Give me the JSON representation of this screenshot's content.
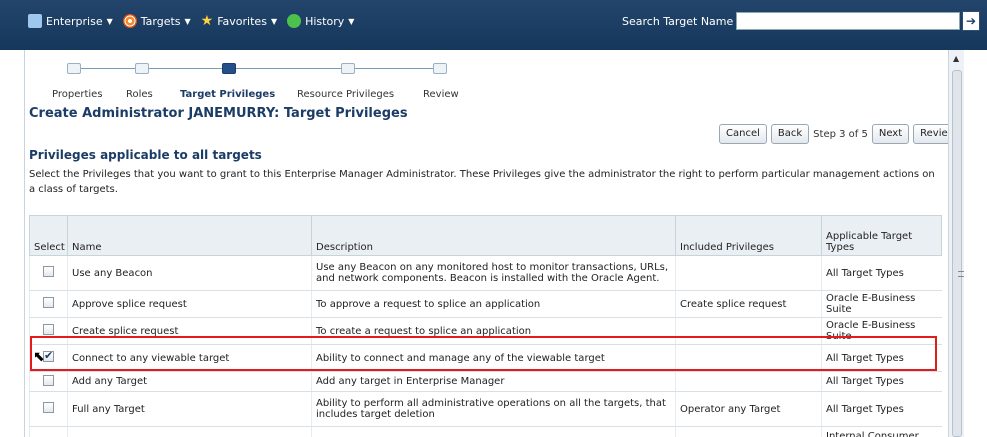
{
  "topbar": {
    "menus": [
      {
        "label": "Enterprise",
        "icon": "enterprise-icon"
      },
      {
        "label": "Targets",
        "icon": "targets-icon"
      },
      {
        "label": "Favorites",
        "icon": "star-icon"
      },
      {
        "label": "History",
        "icon": "history-icon"
      }
    ],
    "search_label": "Search Target Name",
    "search_value": ""
  },
  "train": {
    "steps": [
      "Properties",
      "Roles",
      "Target Privileges",
      "Resource Privileges",
      "Review"
    ],
    "active_index": 2
  },
  "page_title": "Create Administrator JANEMURRY: Target Privileges",
  "buttons": {
    "cancel": "Cancel",
    "back": "Back",
    "step": "Step 3 of 5",
    "next": "Next",
    "review": "Review"
  },
  "section_title": "Privileges applicable to all targets",
  "section_desc": "Select the Privileges that you want to grant to this Enterprise Manager Administrator. These Privileges give the administrator the right to perform particular management actions on a class of targets.",
  "table": {
    "columns": [
      "Select",
      "Name",
      "Description",
      "Included Privileges",
      "Applicable Target Types"
    ],
    "rows": [
      {
        "checked": false,
        "name": "Use any Beacon",
        "description": "Use any Beacon on any monitored host to monitor transactions, URLs, and network components. Beacon is installed with the Oracle Agent.",
        "included": "",
        "types": "All Target Types"
      },
      {
        "checked": false,
        "name": "Approve splice request",
        "description": "To approve a request to splice an application",
        "included": "Create splice request",
        "types": "Oracle E-Business Suite"
      },
      {
        "checked": false,
        "name": "Create splice request",
        "description": "To create a request to splice an application",
        "included": "",
        "types": "Oracle E-Business Suite"
      },
      {
        "checked": true,
        "name": "Connect to any viewable target",
        "description": "Ability to connect and manage any of the viewable target",
        "included": "",
        "types": "All Target Types"
      },
      {
        "checked": false,
        "name": "Add any Target",
        "description": "Add any target in Enterprise Manager",
        "included": "",
        "types": "All Target Types"
      },
      {
        "checked": false,
        "name": "Full any Target",
        "description": "Ability to perform all administrative operations on all the targets, that includes target deletion",
        "included": "Operator any Target",
        "types": "All Target Types"
      },
      {
        "checked": false,
        "name": "",
        "description": "",
        "included": "",
        "types": "Internal Consumer"
      }
    ]
  },
  "colors": {
    "topbar": "#1d3f66",
    "title": "#1b3c66",
    "highlight": "#e21b1b",
    "active_step": "#24508a"
  }
}
